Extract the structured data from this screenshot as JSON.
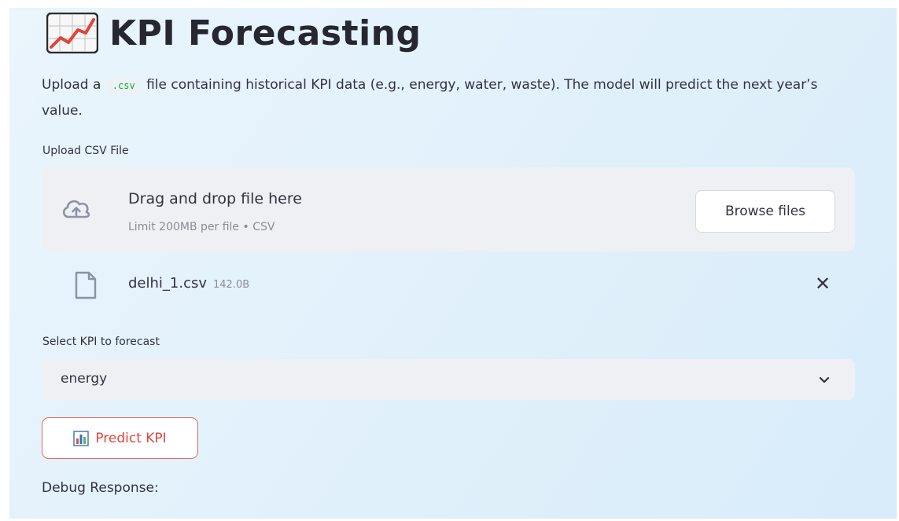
{
  "header": {
    "icon": "chart-increasing-icon",
    "title": "KPI Forecasting"
  },
  "description": {
    "part1": "Upload a",
    "code": ".csv",
    "part2": "file containing historical KPI data (e.g., energy, water, waste). The model will predict the next year’s value."
  },
  "uploader": {
    "label": "Upload CSV File",
    "drop_title": "Drag and drop file here",
    "limit_text": "Limit 200MB per file • CSV",
    "browse_label": "Browse files",
    "icon": "cloud-upload-icon"
  },
  "uploaded_file": {
    "name": "delhi_1.csv",
    "size": "142.0B",
    "icon": "file-icon",
    "remove_label": "✕"
  },
  "kpi_select": {
    "label": "Select KPI to forecast",
    "value": "energy",
    "icon": "chevron-down-icon"
  },
  "predict_button": {
    "icon": "bar-chart-icon",
    "label": "Predict KPI"
  },
  "debug": {
    "label": "Debug Response:"
  },
  "colors": {
    "accent_red": "#e0453b",
    "code_green": "#09ab3b",
    "background": "#e2f1fb"
  }
}
